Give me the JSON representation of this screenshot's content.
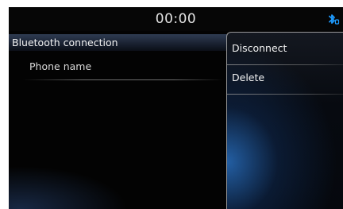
{
  "status_bar": {
    "clock": "00:00",
    "bluetooth_icon": "bluetooth-connected-icon",
    "bluetooth_icon_color": "#1e9bff"
  },
  "list": {
    "header": "Bluetooth connection",
    "items": [
      {
        "label": "Phone name"
      }
    ]
  },
  "popup_menu": {
    "items": [
      {
        "label": "Disconnect"
      },
      {
        "label": "Delete"
      }
    ]
  },
  "colors": {
    "accent": "#1e9bff",
    "background": "#030303"
  }
}
